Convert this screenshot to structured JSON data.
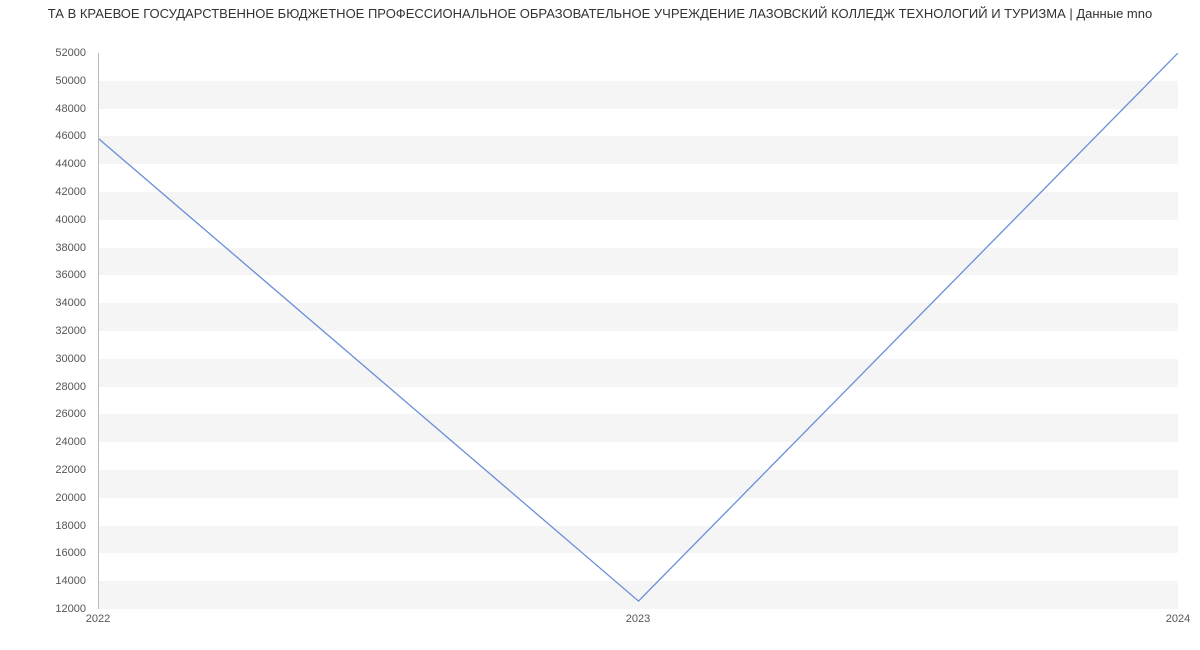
{
  "chart_data": {
    "type": "line",
    "title": "ТА В КРАЕВОЕ ГОСУДАРСТВЕННОЕ БЮДЖЕТНОЕ ПРОФЕССИОНАЛЬНОЕ ОБРАЗОВАТЕЛЬНОЕ УЧРЕЖДЕНИЕ ЛАЗОВСКИЙ КОЛЛЕДЖ ТЕХНОЛОГИЙ И ТУРИЗМА | Данные mno",
    "xlabel": "",
    "ylabel": "",
    "x": [
      "2022",
      "2023",
      "2024"
    ],
    "values": [
      45800,
      12500,
      52000
    ],
    "ylim": [
      12000,
      52000
    ],
    "y_ticks": [
      12000,
      14000,
      16000,
      18000,
      20000,
      22000,
      24000,
      26000,
      28000,
      30000,
      32000,
      34000,
      36000,
      38000,
      40000,
      42000,
      44000,
      46000,
      48000,
      50000,
      52000
    ],
    "line_color": "#6a8fd8"
  }
}
